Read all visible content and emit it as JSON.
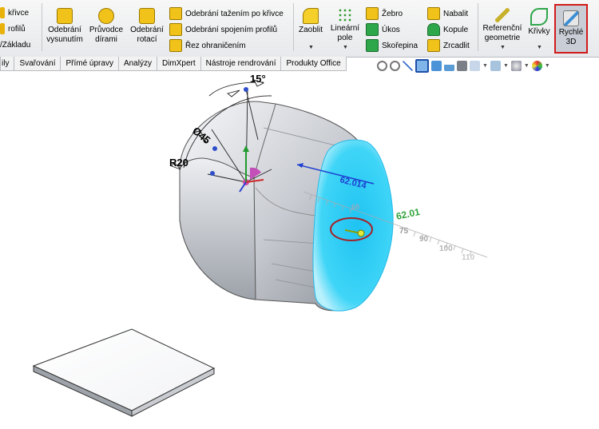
{
  "ribbon": {
    "left_partial": [
      "křivce",
      "rofilů",
      "/Základu"
    ],
    "odebrani_vysunutim": [
      "Odebrání",
      "vysunutím"
    ],
    "pruvodce_dirami": [
      "Průvodce",
      "dírami"
    ],
    "odebrani_rotaci": [
      "Odebrání",
      "rotací"
    ],
    "cut_sweep": "Odebrání tažením po křivce",
    "cut_loft": "Odebrání spojením profilů",
    "boundary_cut": "Řez ohraničením",
    "zaoblit": "Zaoblit",
    "linearni_pole": [
      "Lineární",
      "pole"
    ],
    "zebro": "Žebro",
    "ukos": "Úkos",
    "skorepina": "Skořepina",
    "nabalit": "Nabalit",
    "kopule": "Kopule",
    "zrcadlit": "Zrcadlit",
    "referencni_geometrie": [
      "Referenční",
      "geometrie"
    ],
    "krivky": "Křivky",
    "rychle_3d": [
      "Rychlé",
      "3D"
    ]
  },
  "tabs": [
    "ily",
    "Svařování",
    "Přímé úpravy",
    "Analýzy",
    "DimXpert",
    "Nástroje rendrování",
    "Produkty Office"
  ],
  "dimensions": {
    "angle": "15°",
    "diameter": "Ø45",
    "radius": "R20",
    "ruler_value": "62.014",
    "live_value": "62.01",
    "ticks": [
      "60",
      "75",
      "90",
      "100",
      "110"
    ]
  },
  "colors": {
    "accent_red": "#d11a1a",
    "face_cyan": "#3ad0f5",
    "body_gray": "#c9ccd2"
  }
}
